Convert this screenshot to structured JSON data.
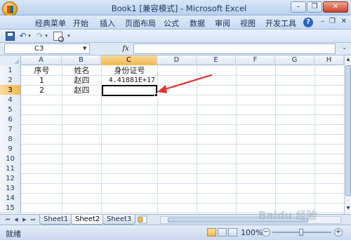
{
  "window": {
    "title": "Book1  [兼容模式] - Microsoft Excel",
    "minimize_glyph": "–",
    "restore_glyph": "❐",
    "close_glyph": "✕"
  },
  "ribbon": {
    "tabs": [
      {
        "label": "经典菜单"
      },
      {
        "label": "开始"
      },
      {
        "label": "插入"
      },
      {
        "label": "页面布局"
      },
      {
        "label": "公式"
      },
      {
        "label": "数据"
      },
      {
        "label": "审阅"
      },
      {
        "label": "视图"
      },
      {
        "label": "开发工具"
      }
    ],
    "help_glyph": "?",
    "minimize_glyph": "–",
    "restore_glyph": "❐",
    "close_glyph": "✕"
  },
  "qat": {
    "undo_glyph": "↶",
    "redo_glyph": "↷",
    "dropdown_glyph": "▾",
    "customize_glyph": "▾"
  },
  "formula_bar": {
    "name_box": "C3",
    "name_box_arrow": "▼",
    "fx_label": "fx",
    "formula_value": "",
    "expand_glyph": "⌄"
  },
  "grid": {
    "columns": [
      "A",
      "B",
      "C",
      "D",
      "E",
      "F",
      "G",
      "H"
    ],
    "rows": [
      "1",
      "2",
      "3",
      "4",
      "5",
      "6",
      "7",
      "8",
      "9",
      "10",
      "11",
      "12",
      "13",
      "14",
      "15"
    ],
    "active_column": "C",
    "active_row": "3",
    "cells": {
      "A1": "序号",
      "B1": "姓名",
      "C1": "身份证号",
      "A2": "1",
      "B2": "赵四",
      "C2": "4.41881E+17",
      "A3": "2",
      "B3": "赵四",
      "C3": ""
    }
  },
  "sheets": {
    "tabs": [
      {
        "label": "Sheet1"
      },
      {
        "label": "Sheet2",
        "active": true
      },
      {
        "label": "Sheet3"
      }
    ],
    "nav": [
      "⏮",
      "◀",
      "▶",
      "⏭"
    ]
  },
  "status": {
    "text": "就绪",
    "zoom_level": "100%",
    "zoom_minus": "−",
    "zoom_plus": "+"
  },
  "watermark": "Baidu 经验",
  "colors": {
    "accent_orange": "#f1b84f",
    "annotation_arrow": "#e0322b"
  }
}
